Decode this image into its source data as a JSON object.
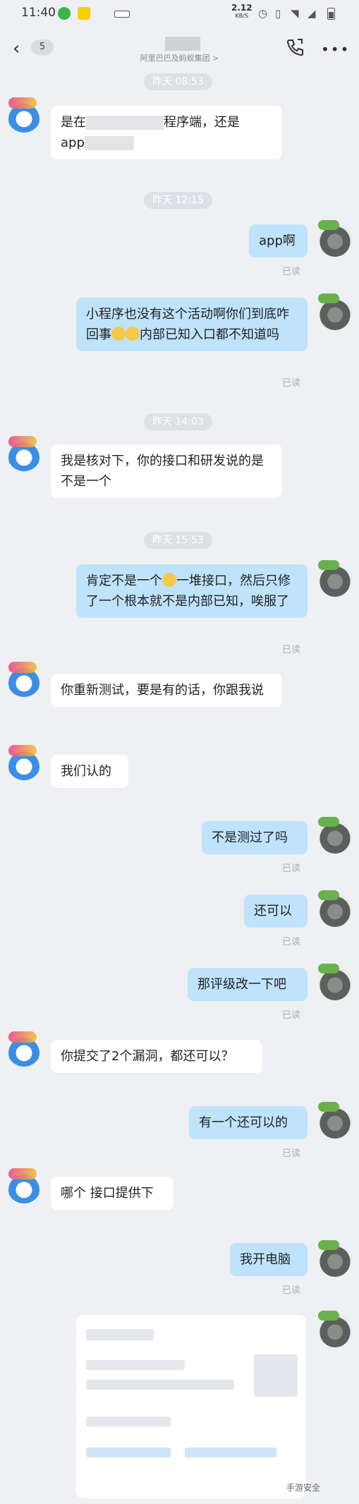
{
  "status": {
    "time": "11:40",
    "speed_value": "2.12",
    "speed_unit": "KB/S",
    "icons": [
      "app-icon",
      "hd-icon",
      "sim-icon",
      "alarm-icon",
      "vibrate-icon",
      "wifi-icon",
      "signal-icon",
      "battery-icon"
    ]
  },
  "header": {
    "back_icon": "chevron-left-icon",
    "unread_count": "5",
    "subtitle": "阿里巴巴及蚂蚁集团 >",
    "call_icon": "phone-icon",
    "more_icon": "more-icon"
  },
  "times": [
    "昨天 08:53",
    "昨天 12:15",
    "昨天 14:03",
    "昨天 15:53"
  ],
  "read_label": "已读",
  "messages": [
    {
      "side": "left",
      "text_a": "是在",
      "text_b": "程序端，还是",
      "text_c": "app"
    },
    {
      "side": "right",
      "text": "app啊"
    },
    {
      "side": "right",
      "text_a": "小程序也没有这个活动啊你们到底咋回事",
      "text_b": "内部已知入口都不知道吗"
    },
    {
      "side": "left",
      "text": "我是核对下，你的接口和研发说的是不是一个"
    },
    {
      "side": "right",
      "text_a": "肯定不是一个",
      "text_b": "一堆接口，然后只修了一个根本就不是内部已知，唉服了"
    },
    {
      "side": "left",
      "text": "你重新测试，要是有的话，你跟我说"
    },
    {
      "side": "left",
      "text": "我们认的"
    },
    {
      "side": "right",
      "text": "不是测过了吗"
    },
    {
      "side": "right",
      "text": "还可以"
    },
    {
      "side": "right",
      "text": "那评级改一下吧"
    },
    {
      "side": "left",
      "text": "你提交了2个漏洞，都还可以？"
    },
    {
      "side": "right",
      "text": "有一个还可以的"
    },
    {
      "side": "left",
      "text": "哪个 接口提供下"
    },
    {
      "side": "right",
      "text": "我开电脑"
    }
  ],
  "watermark": "手游安全",
  "colors": {
    "background": "#eef0f3",
    "bubble_right": "#bfe3fb",
    "bubble_left": "#ffffff",
    "read": "#aab0b8"
  }
}
